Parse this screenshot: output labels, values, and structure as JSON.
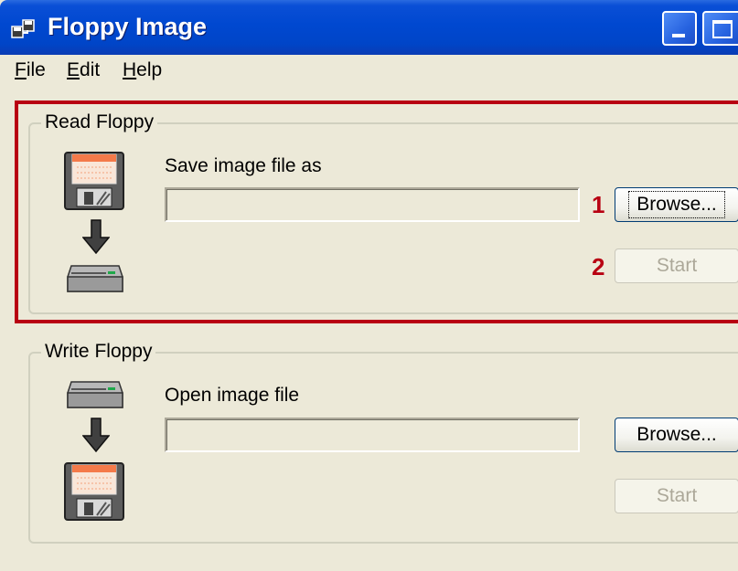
{
  "window": {
    "title": "Floppy Image"
  },
  "menu": {
    "items": [
      "File",
      "Edit",
      "Help"
    ]
  },
  "read": {
    "group_label": "Read Floppy",
    "field_label": "Save image file as",
    "field_value": "",
    "browse_label": "Browse...",
    "start_label": "Start",
    "step1": "1",
    "step2": "2"
  },
  "write": {
    "group_label": "Write Floppy",
    "field_label": "Open image file",
    "field_value": "",
    "browse_label": "Browse...",
    "start_label": "Start"
  },
  "icons": {
    "app": "floppy-stack-icon",
    "floppy": "floppy-disk-icon",
    "arrow": "arrow-down-icon",
    "drive": "floppy-drive-icon"
  },
  "colors": {
    "highlight": "#b80012",
    "titlebar": "#0048d0"
  }
}
